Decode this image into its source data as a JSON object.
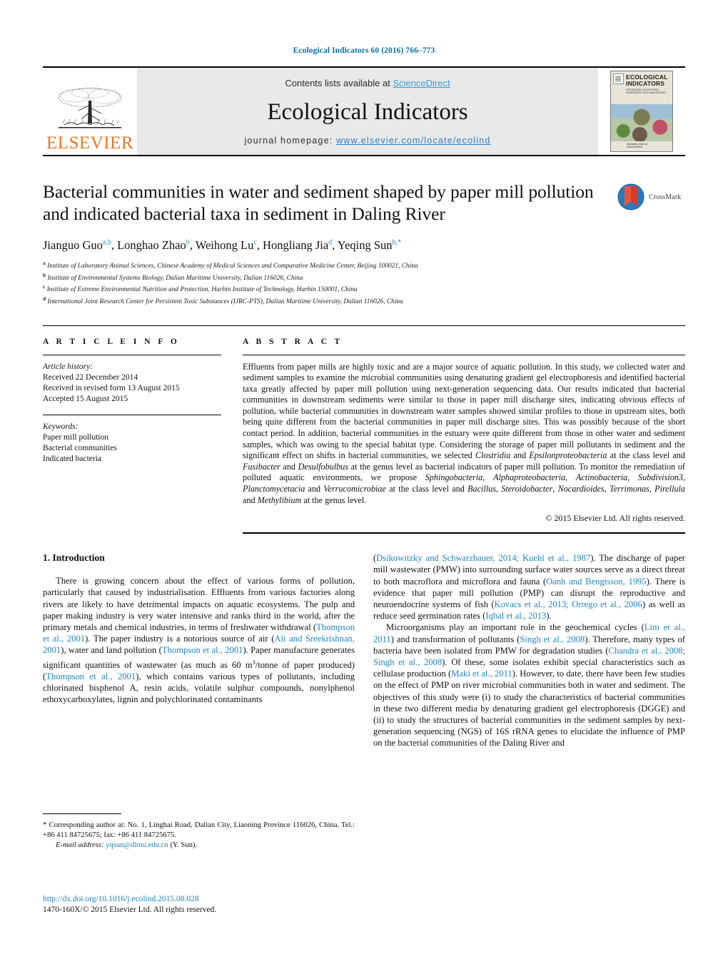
{
  "running_head": "Ecological Indicators 60 (2016) 766–773",
  "masthead": {
    "publisher_name": "ELSEVIER",
    "contents_prefix": "Contents lists available at ",
    "sciencedirect": "ScienceDirect",
    "journal_title": "Ecological Indicators",
    "homepage_prefix": "journal homepage: ",
    "homepage_url": "www.elsevier.com/locate/ecolind",
    "cover": {
      "title_line1": "ECOLOGICAL",
      "title_line2": "INDICATORS",
      "subtitle": "INTEGRATING MONITORING, ASSESSMENT AND MANAGEMENT",
      "footer": "Available online at\nScienceDirect"
    }
  },
  "article": {
    "title": "Bacterial communities in water and sediment shaped by paper mill pollution and indicated bacterial taxa in sediment in Daling River",
    "crossmark_label": "CrossMark",
    "authors_html": "Jianguo Guo<sup>a,b</sup>, Longhao Zhao<sup>b</sup>, Weihong Lu<sup>c</sup>, Hongliang Jia<sup>d</sup>, Yeqing Sun<sup>b,*</sup>",
    "affiliations": [
      {
        "marker": "a",
        "text": "Institute of Laboratory Animal Sciences, Chinese Academy of Medical Sciences and Comparative Medicine Center, Beijing 100021, China"
      },
      {
        "marker": "b",
        "text": "Institute of Environmental Systems Biology, Dalian Maritime University, Dalian 116026, China"
      },
      {
        "marker": "c",
        "text": "Institute of Extreme Environmental Nutrition and Protection, Harbin Institute of Technology, Harbin 150001, China"
      },
      {
        "marker": "d",
        "text": "International Joint Research Center for Persistent Toxic Substances (IJRC-PTS), Dalian Maritime University, Dalian 116026, China"
      }
    ]
  },
  "article_info": {
    "heading": "A R T I C L E   I N F O",
    "history_heading": "Article history:",
    "history": [
      "Received 22 December 2014",
      "Received in revised form 13 August 2015",
      "Accepted 15 August 2015"
    ],
    "keywords_heading": "Keywords:",
    "keywords": [
      "Paper mill pollution",
      "Bacterial communities",
      "Indicated bacteria"
    ]
  },
  "abstract": {
    "heading": "A B S T R A C T",
    "body_html": "Effluents from paper mills are highly toxic and are a major source of aquatic pollution. In this study, we collected water and sediment samples to examine the microbial communities using denaturing gradient gel electrophoresis and identified bacterial taxa greatly affected by paper mill pollution using next-generation sequencing data. Our results indicated that bacterial communities in downstream sediments were similar to those in paper mill discharge sites, indicating obvious effects of pollution, while bacterial communities in downstream water samples showed similar profiles to those in upstream sites, both being quite different from the bacterial communities in paper mill discharge sites. This was possibly because of the short contact period. In addition, bacterial communities in the estuary were quite different from those in other water and sediment samples, which was owing to the special habitat type. Considering the storage of paper mill pollutants in sediment and the significant effect on shifts in bacterial communities, we selected <i>Clostridia</i> and <i>Epsilonproteobacteria</i> at the class level and <i>Fusibacter</i> and <i>Desulfobulbus</i> at the genus level as bacterial indicators of paper mill pollution. To monitor the remediation of polluted aquatic environments, we propose <i>Sphingobacteria</i>, <i>Alphaproteobacteria</i>, <i>Actinobacteria</i>, <i>Subdivision3</i>, <i>Planctomycetacia</i> and <i>Verrucomicrobiae</i> at the class level and <i>Bacillus</i>, <i>Steroidobacter</i>, <i>Nocardioides</i>, <i>Terrimonas</i>, <i>Pirellula</i> and <i>Methylibium</i> at the genus level.",
    "copyright": "© 2015 Elsevier Ltd. All rights reserved."
  },
  "introduction": {
    "heading": "1.  Introduction",
    "left_para1_html": "There is growing concern about the effect of various forms of pollution, particularly that caused by industrialisation. Effluents from various factories along rivers are likely to have detrimental impacts on aquatic ecosystems. The pulp and paper making industry is very water intensive and ranks third in the world, after the primary metals and chemical industries, in terms of freshwater withdrawal (<span class=\"ref\">Thompson et al., 2001</span>). The paper industry is a notorious source of air (<span class=\"ref\">Ali and Sreekrishnan, 2001</span>), water and land pollution (<span class=\"ref\">Thompson et al., 2001</span>). Paper manufacture generates significant quantities of wastewater (as much as 60 m<sup>3</sup>/tonne of paper produced) (<span class=\"ref\">Thompson et al., 2001</span>), which contains various types of pollutants, including chlorinated bisphenol A, resin acids, volatile sulphur compounds, nonylphenol ethoxycarboxylates, lignin and polychlorinated contaminants",
    "right_para1_html": "(<span class=\"ref\">Dsikowitzky and Schwarzbauer, 2014; Kuehl et al., 1987</span>). The discharge of paper mill wastewater (PMW) into surrounding surface water sources serve as a direct threat to both macroflora and microflora and fauna (<span class=\"ref\">Oanh and Bengtsson, 1995</span>). There is evidence that paper mill pollution (PMP) can disrupt the reproductive and neuroendocrine systems of fish (<span class=\"ref\">Kovacs et al., 2013; Orrego et al., 2006</span>) as well as reduce seed germination rates (<span class=\"ref\">Iqbal et al., 2013</span>).",
    "right_para2_html": "Microorganisms play an important role in the geochemical cycles (<span class=\"ref\">Lim et al., 2011</span>) and transformation of pollutants (<span class=\"ref\">Singh et al., 2008</span>). Therefore, many types of bacteria have been isolated from PMW for degradation studies (<span class=\"ref\">Chandra et al., 2008; Singh et al., 2008</span>). Of these, some isolates exhibit special characteristics such as cellulase production (<span class=\"ref\">Maki et al., 2011</span>). However, to date, there have been few studies on the effect of PMP on river microbial communities both in water and sediment. The objectives of this study were (i) to study the characteristics of bacterial communities in these two different media by denaturing gradient gel electrophoresis (DGGE) and (ii) to study the structures of bacterial communities in the sediment samples by next-generation sequencing (NGS) of 16S rRNA genes to elucidate the influence of PMP on the bacterial communities of the Daling River and"
  },
  "footnote": {
    "star": "*",
    "corresponding_html": "Corresponding author at: No. 1, Linghai Road, Dalian City, Liaoning Province 116026, China. Tel.: +86 411 84725675; fax: +86 411 84725675.",
    "email_label": "E-mail address:",
    "email": "yqsun@dlmu.edu.cn",
    "email_suffix": "(Y. Sun)."
  },
  "doi_block": {
    "doi_url": "http://dx.doi.org/10.1016/j.ecolind.2015.08.028",
    "issn_line": "1470-160X/© 2015 Elsevier Ltd. All rights reserved."
  },
  "colors": {
    "link_blue": "#1f84c0",
    "header_blue": "#0b6ea8",
    "elsevier_orange": "#E87722",
    "sciencedirect_blue": "#3a9ad9",
    "crossmark_blue": "#2b7bb9",
    "crossmark_red": "#d93b2b"
  }
}
